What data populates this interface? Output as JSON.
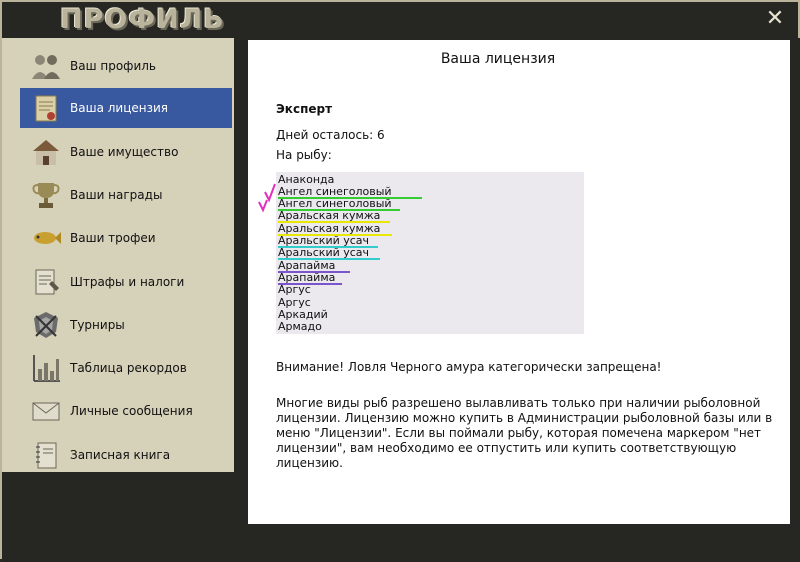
{
  "window": {
    "title": "ПРОФИЛЬ",
    "close_icon": "close-icon"
  },
  "sidebar": {
    "items": [
      {
        "label": "Ваш профиль",
        "icon": "people-icon",
        "active": false
      },
      {
        "label": "Ваша лицензия",
        "icon": "license-document-icon",
        "active": true
      },
      {
        "label": "Ваше имущество",
        "icon": "house-icon",
        "active": false
      },
      {
        "label": "Ваши награды",
        "icon": "trophy-cup-icon",
        "active": false
      },
      {
        "label": "Ваши трофеи",
        "icon": "fish-trophy-icon",
        "active": false
      },
      {
        "label": "Штрафы и налоги",
        "icon": "fine-document-icon",
        "active": false
      },
      {
        "label": "Турниры",
        "icon": "tournament-emblem-icon",
        "active": false
      },
      {
        "label": "Таблица рекордов",
        "icon": "bar-chart-icon",
        "active": false
      },
      {
        "label": "Личные сообщения",
        "icon": "envelope-icon",
        "active": false
      },
      {
        "label": "Записная книга",
        "icon": "notebook-icon",
        "active": false
      }
    ]
  },
  "main": {
    "title": "Ваша лицензия",
    "level": "Эксперт",
    "days_left": "Дней осталось: 6",
    "fish_label": "На рыбу:",
    "fish_list": [
      "Анаконда",
      "Ангел синеголовый",
      "Ангел синеголовый",
      "Аральская кумжа",
      "Аральская кумжа",
      "Аральский усач",
      "Аральский усач",
      "Арапайма",
      "Арапайма",
      "Аргус",
      "Аргус",
      "Аркадий",
      "Армадо"
    ],
    "warning": "Внимание! Ловля Черного амура категорически запрещена!",
    "info": "Многие виды рыб разрешено вылавливать только при наличии рыболовной лицензии. Лицензию можно купить в Администрации рыболовной базы или в меню \"Лицензии\". Если вы поймали рыбу, которая помечена маркером \"нет лицензии\", вам необходимо ее отпустить или купить соответствующую лицензию."
  },
  "annotations": {
    "underline_colors": [
      "#33cc33",
      "#33cc33",
      "#e8e800",
      "#e8e800",
      "#33cccc",
      "#33cccc",
      "#7a55cc",
      "#7a55cc"
    ],
    "checkmark_color": "#e030c0"
  },
  "colors": {
    "accent": "#3858a0",
    "frame": "#d6d1b9",
    "dark": "#262622"
  }
}
